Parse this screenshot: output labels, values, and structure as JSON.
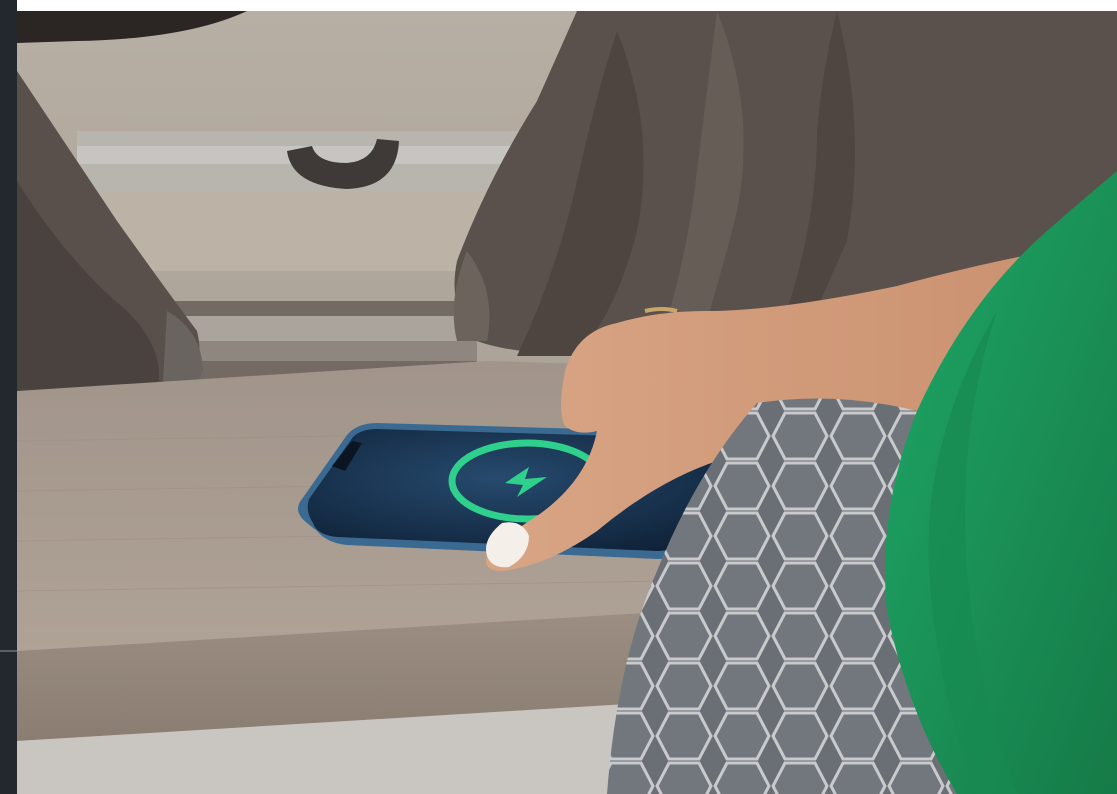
{
  "page": {
    "sidebar_color": "#23282e",
    "top_bar_color": "#ffffff"
  },
  "photo": {
    "subject": "hand-placing-smartphone-on-wireless-charging-shelf",
    "colors": {
      "wall": "#b5aba0",
      "curtain": "#5b514c",
      "shelf": "#a89b8e",
      "carpet": "#c9c6c2",
      "cushion": "#6c7177",
      "sleeve": "#1e9a5b",
      "skin": "#d9a98a",
      "phone_body": "#3a6a92",
      "phone_screen": "#142c48",
      "charge_ring": "#2fd08b"
    },
    "icons": {
      "charge_icon": "lightning-bolt"
    }
  }
}
